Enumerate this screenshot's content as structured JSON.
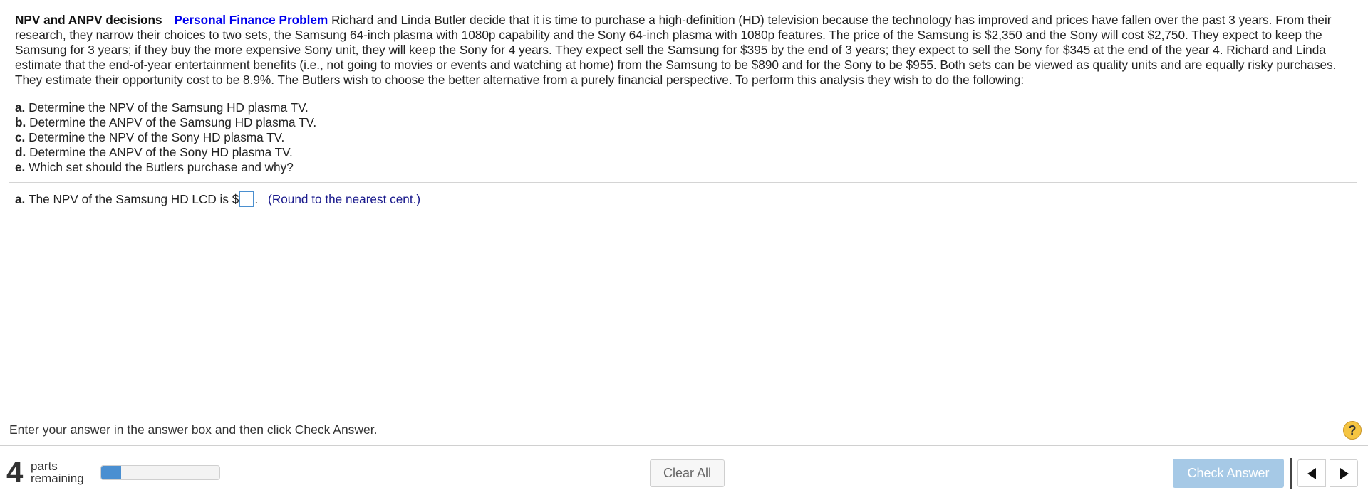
{
  "problem": {
    "title": "NPV and ANPV decisions",
    "tag": "Personal Finance Problem",
    "text": "Richard and Linda Butler decide that it is time to purchase a high-definition (HD) television because the technology has improved and prices have fallen over the past 3 years. From their research, they narrow their choices to two sets, the Samsung 64-inch plasma with 1080p capability and the Sony 64-inch plasma with 1080p features.  The price of the Samsung is $2,350 and the Sony will cost $2,750. They expect to keep the Samsung for 3 years; if they buy the more expensive Sony unit, they will keep the Sony for 4 years.  They expect  sell the Samsung for $395 by the end of 3 years; they expect to sell the Sony for $345 at the end of the year 4. Richard and Linda estimate that the end-of-year entertainment benefits (i.e., not going to movies or events and watching at home) from the Samsung to be $890 and for the Sony to be $955. Both sets can be viewed as quality units and are equally risky purchases.  They estimate their opportunity cost to be 8.9%.  The Butlers wish to choose the better alternative from a purely financial perspective.  To perform this analysis they wish to do the following:"
  },
  "parts": [
    {
      "letter": "a.",
      "text": "Determine the NPV of the Samsung HD plasma TV."
    },
    {
      "letter": "b.",
      "text": "Determine the ANPV of the Samsung HD plasma TV."
    },
    {
      "letter": "c.",
      "text": "Determine the NPV of the Sony HD plasma TV."
    },
    {
      "letter": "d.",
      "text": "Determine the ANPV of the Sony HD plasma TV."
    },
    {
      "letter": "e.",
      "text": "Which set should the Butlers purchase and why?"
    }
  ],
  "answer": {
    "letter": "a.",
    "prefix": "The NPV of the Samsung HD LCD is $",
    "suffix": ".",
    "value": "",
    "hint": "(Round to the nearest cent.)"
  },
  "footer": {
    "instruction": "Enter your answer in the answer box and then click Check Answer.",
    "help_icon": "question-icon",
    "help_symbol": "?",
    "parts_count": "4",
    "parts_label_line1": "parts",
    "parts_label_line2": "remaining",
    "progress_fraction": 0.17,
    "clear_label": "Clear All",
    "check_label": "Check Answer",
    "prev_icon": "triangle-left-icon",
    "next_icon": "triangle-right-icon"
  },
  "colors": {
    "tag": "#0000ee",
    "hint": "#1a1a8c",
    "progress_fill": "#4a8fd1",
    "check_button": "#a6c9e6",
    "help_button": "#f5c542"
  }
}
